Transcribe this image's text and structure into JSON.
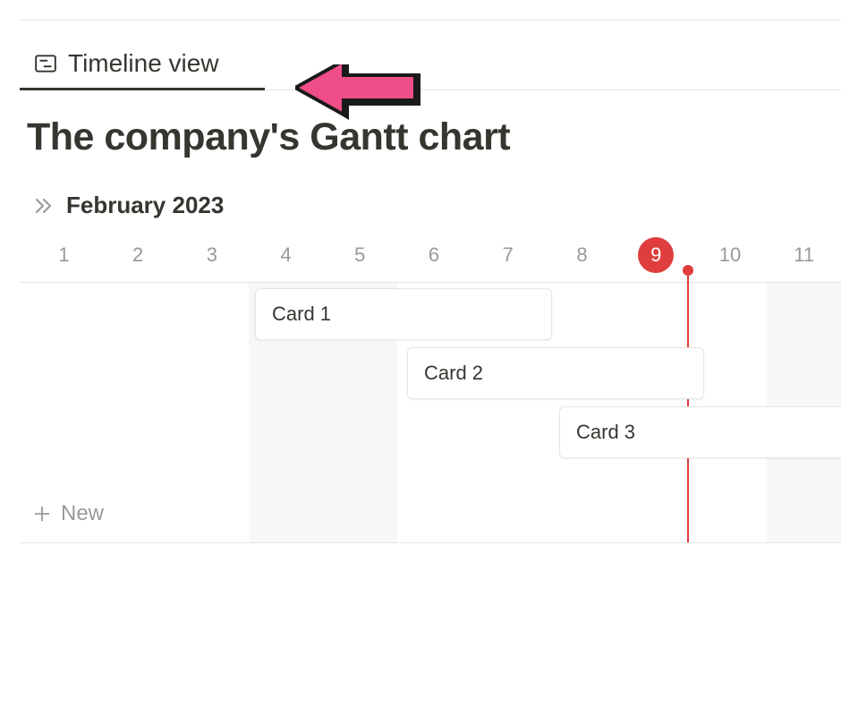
{
  "tab": {
    "label": "Timeline view"
  },
  "title": "The company's Gantt chart",
  "month": "February 2023",
  "days": [
    "1",
    "2",
    "3",
    "4",
    "5",
    "6",
    "7",
    "8",
    "9",
    "10",
    "11"
  ],
  "today_index": 8,
  "weekend_indices": [
    3,
    4,
    10
  ],
  "cards": [
    {
      "label": "Card 1",
      "start_day_index": 3,
      "span_days": 4
    },
    {
      "label": "Card 2",
      "start_day_index": 5,
      "span_days": 4
    },
    {
      "label": "Card 3",
      "start_day_index": 7,
      "span_days": 5
    }
  ],
  "new_label": "New",
  "annotation": "arrow-pointing-to-tab",
  "colors": {
    "today": "#e03e3e",
    "text": "#37352f",
    "muted": "#999",
    "arrow_fill": "#ef4d88",
    "arrow_stroke": "#1a1a1a"
  }
}
